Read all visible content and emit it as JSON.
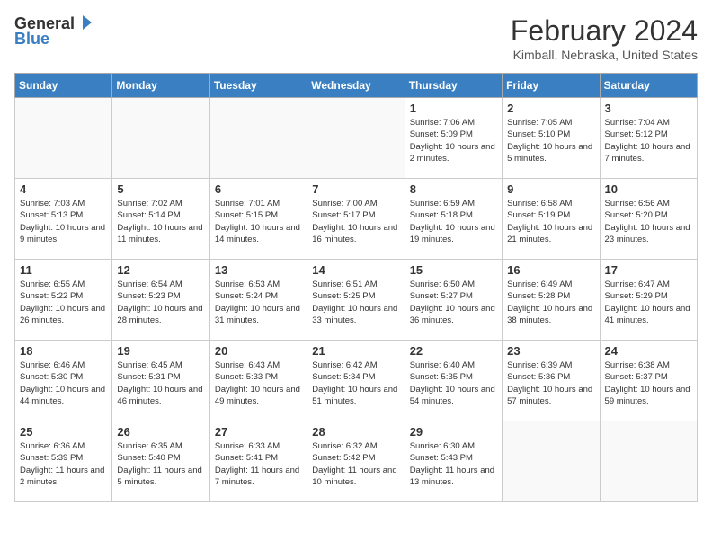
{
  "header": {
    "logo_general": "General",
    "logo_blue": "Blue",
    "title": "February 2024",
    "subtitle": "Kimball, Nebraska, United States"
  },
  "days_of_week": [
    "Sunday",
    "Monday",
    "Tuesday",
    "Wednesday",
    "Thursday",
    "Friday",
    "Saturday"
  ],
  "weeks": [
    [
      {
        "day": "",
        "sunrise": "",
        "sunset": "",
        "daylight": "",
        "empty": true
      },
      {
        "day": "",
        "sunrise": "",
        "sunset": "",
        "daylight": "",
        "empty": true
      },
      {
        "day": "",
        "sunrise": "",
        "sunset": "",
        "daylight": "",
        "empty": true
      },
      {
        "day": "",
        "sunrise": "",
        "sunset": "",
        "daylight": "",
        "empty": true
      },
      {
        "day": "1",
        "sunrise": "Sunrise: 7:06 AM",
        "sunset": "Sunset: 5:09 PM",
        "daylight": "Daylight: 10 hours and 2 minutes."
      },
      {
        "day": "2",
        "sunrise": "Sunrise: 7:05 AM",
        "sunset": "Sunset: 5:10 PM",
        "daylight": "Daylight: 10 hours and 5 minutes."
      },
      {
        "day": "3",
        "sunrise": "Sunrise: 7:04 AM",
        "sunset": "Sunset: 5:12 PM",
        "daylight": "Daylight: 10 hours and 7 minutes."
      }
    ],
    [
      {
        "day": "4",
        "sunrise": "Sunrise: 7:03 AM",
        "sunset": "Sunset: 5:13 PM",
        "daylight": "Daylight: 10 hours and 9 minutes."
      },
      {
        "day": "5",
        "sunrise": "Sunrise: 7:02 AM",
        "sunset": "Sunset: 5:14 PM",
        "daylight": "Daylight: 10 hours and 11 minutes."
      },
      {
        "day": "6",
        "sunrise": "Sunrise: 7:01 AM",
        "sunset": "Sunset: 5:15 PM",
        "daylight": "Daylight: 10 hours and 14 minutes."
      },
      {
        "day": "7",
        "sunrise": "Sunrise: 7:00 AM",
        "sunset": "Sunset: 5:17 PM",
        "daylight": "Daylight: 10 hours and 16 minutes."
      },
      {
        "day": "8",
        "sunrise": "Sunrise: 6:59 AM",
        "sunset": "Sunset: 5:18 PM",
        "daylight": "Daylight: 10 hours and 19 minutes."
      },
      {
        "day": "9",
        "sunrise": "Sunrise: 6:58 AM",
        "sunset": "Sunset: 5:19 PM",
        "daylight": "Daylight: 10 hours and 21 minutes."
      },
      {
        "day": "10",
        "sunrise": "Sunrise: 6:56 AM",
        "sunset": "Sunset: 5:20 PM",
        "daylight": "Daylight: 10 hours and 23 minutes."
      }
    ],
    [
      {
        "day": "11",
        "sunrise": "Sunrise: 6:55 AM",
        "sunset": "Sunset: 5:22 PM",
        "daylight": "Daylight: 10 hours and 26 minutes."
      },
      {
        "day": "12",
        "sunrise": "Sunrise: 6:54 AM",
        "sunset": "Sunset: 5:23 PM",
        "daylight": "Daylight: 10 hours and 28 minutes."
      },
      {
        "day": "13",
        "sunrise": "Sunrise: 6:53 AM",
        "sunset": "Sunset: 5:24 PM",
        "daylight": "Daylight: 10 hours and 31 minutes."
      },
      {
        "day": "14",
        "sunrise": "Sunrise: 6:51 AM",
        "sunset": "Sunset: 5:25 PM",
        "daylight": "Daylight: 10 hours and 33 minutes."
      },
      {
        "day": "15",
        "sunrise": "Sunrise: 6:50 AM",
        "sunset": "Sunset: 5:27 PM",
        "daylight": "Daylight: 10 hours and 36 minutes."
      },
      {
        "day": "16",
        "sunrise": "Sunrise: 6:49 AM",
        "sunset": "Sunset: 5:28 PM",
        "daylight": "Daylight: 10 hours and 38 minutes."
      },
      {
        "day": "17",
        "sunrise": "Sunrise: 6:47 AM",
        "sunset": "Sunset: 5:29 PM",
        "daylight": "Daylight: 10 hours and 41 minutes."
      }
    ],
    [
      {
        "day": "18",
        "sunrise": "Sunrise: 6:46 AM",
        "sunset": "Sunset: 5:30 PM",
        "daylight": "Daylight: 10 hours and 44 minutes."
      },
      {
        "day": "19",
        "sunrise": "Sunrise: 6:45 AM",
        "sunset": "Sunset: 5:31 PM",
        "daylight": "Daylight: 10 hours and 46 minutes."
      },
      {
        "day": "20",
        "sunrise": "Sunrise: 6:43 AM",
        "sunset": "Sunset: 5:33 PM",
        "daylight": "Daylight: 10 hours and 49 minutes."
      },
      {
        "day": "21",
        "sunrise": "Sunrise: 6:42 AM",
        "sunset": "Sunset: 5:34 PM",
        "daylight": "Daylight: 10 hours and 51 minutes."
      },
      {
        "day": "22",
        "sunrise": "Sunrise: 6:40 AM",
        "sunset": "Sunset: 5:35 PM",
        "daylight": "Daylight: 10 hours and 54 minutes."
      },
      {
        "day": "23",
        "sunrise": "Sunrise: 6:39 AM",
        "sunset": "Sunset: 5:36 PM",
        "daylight": "Daylight: 10 hours and 57 minutes."
      },
      {
        "day": "24",
        "sunrise": "Sunrise: 6:38 AM",
        "sunset": "Sunset: 5:37 PM",
        "daylight": "Daylight: 10 hours and 59 minutes."
      }
    ],
    [
      {
        "day": "25",
        "sunrise": "Sunrise: 6:36 AM",
        "sunset": "Sunset: 5:39 PM",
        "daylight": "Daylight: 11 hours and 2 minutes."
      },
      {
        "day": "26",
        "sunrise": "Sunrise: 6:35 AM",
        "sunset": "Sunset: 5:40 PM",
        "daylight": "Daylight: 11 hours and 5 minutes."
      },
      {
        "day": "27",
        "sunrise": "Sunrise: 6:33 AM",
        "sunset": "Sunset: 5:41 PM",
        "daylight": "Daylight: 11 hours and 7 minutes."
      },
      {
        "day": "28",
        "sunrise": "Sunrise: 6:32 AM",
        "sunset": "Sunset: 5:42 PM",
        "daylight": "Daylight: 11 hours and 10 minutes."
      },
      {
        "day": "29",
        "sunrise": "Sunrise: 6:30 AM",
        "sunset": "Sunset: 5:43 PM",
        "daylight": "Daylight: 11 hours and 13 minutes."
      },
      {
        "day": "",
        "sunrise": "",
        "sunset": "",
        "daylight": "",
        "empty": true
      },
      {
        "day": "",
        "sunrise": "",
        "sunset": "",
        "daylight": "",
        "empty": true
      }
    ]
  ]
}
